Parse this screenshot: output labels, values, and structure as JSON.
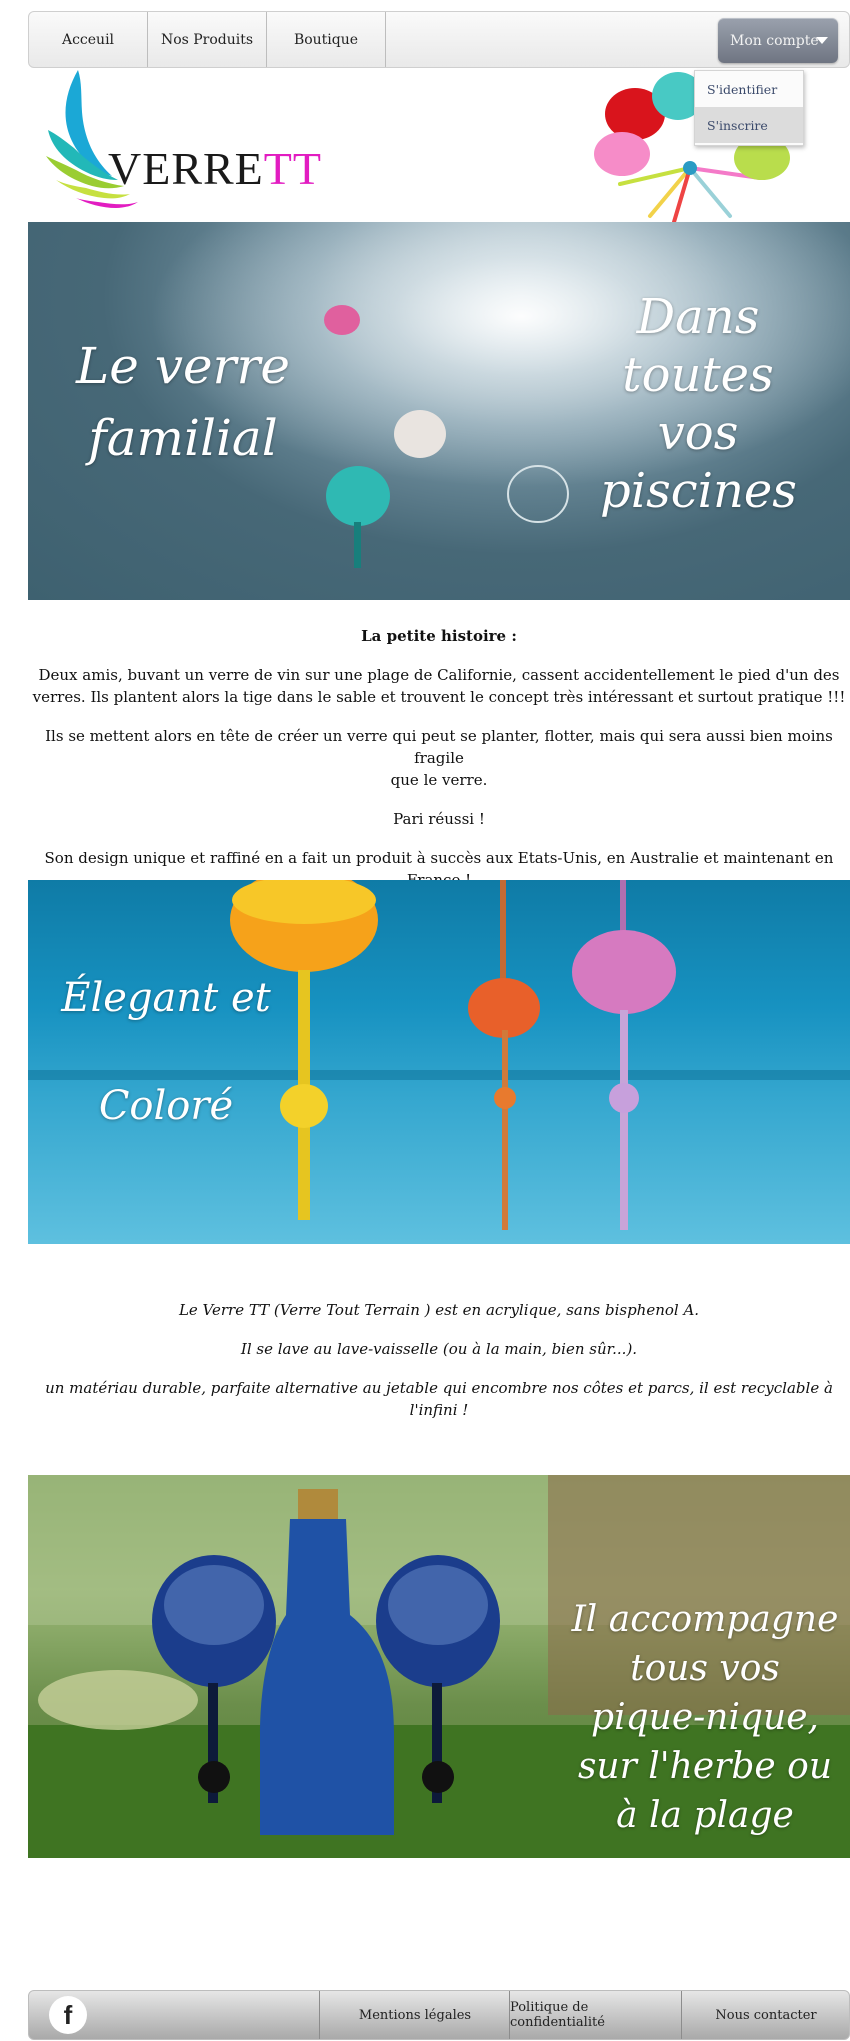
{
  "nav": {
    "items": [
      "Acceuil",
      "Nos Produits",
      "Boutique"
    ],
    "account": {
      "label": "Mon compte",
      "menu": [
        "S'identifier",
        "S'inscrire"
      ]
    }
  },
  "logo": {
    "text_main": "VERRE",
    "text_accent": "TT",
    "accent_color": "#e21cc1"
  },
  "banner1": {
    "left_text": [
      "Le verre",
      "familial"
    ],
    "right_text": [
      "Dans",
      "toutes",
      "vos",
      "piscines"
    ]
  },
  "story": {
    "title": "La petite histoire :",
    "p1": [
      "Deux amis, buvant un verre de vin sur une plage de Californie, cassent accidentellement le pied d'un des",
      "verres. Ils plantent alors la tige dans le sable et trouvent le concept  très intéressant et surtout pratique !!!"
    ],
    "p2": [
      "Ils se mettent  alors en tête de créer un verre qui peut se planter, flotter, mais qui sera aussi bien moins fragile",
      "que le verre."
    ],
    "p3": "Pari réussi !",
    "p4": [
      "Son design unique et raffiné en a fait un produit à succès aux Etats-Unis, en Australie et maintenant en",
      "France !"
    ]
  },
  "banner2": {
    "line1": "Élegant et",
    "line2": "Coloré"
  },
  "features": {
    "p1": "Le Verre TT (Verre Tout Terrain ) est en acrylique, sans bisphenol A.",
    "p2": "Il se lave au lave-vaisselle (ou à la main, bien sûr...).",
    "p3": [
      "un matériau durable, parfaite alternative au jetable qui encombre nos côtes et parcs, il est recyclable à",
      "l'infini !"
    ]
  },
  "banner3": {
    "lines": [
      "Il accompagne",
      "tous vos",
      "pique-nique,",
      "sur l'herbe ou",
      "à la plage"
    ]
  },
  "footer": {
    "icon": "facebook-icon",
    "links": [
      "Mentions légales",
      "Politique de confidentialité",
      "Nous contacter"
    ]
  }
}
